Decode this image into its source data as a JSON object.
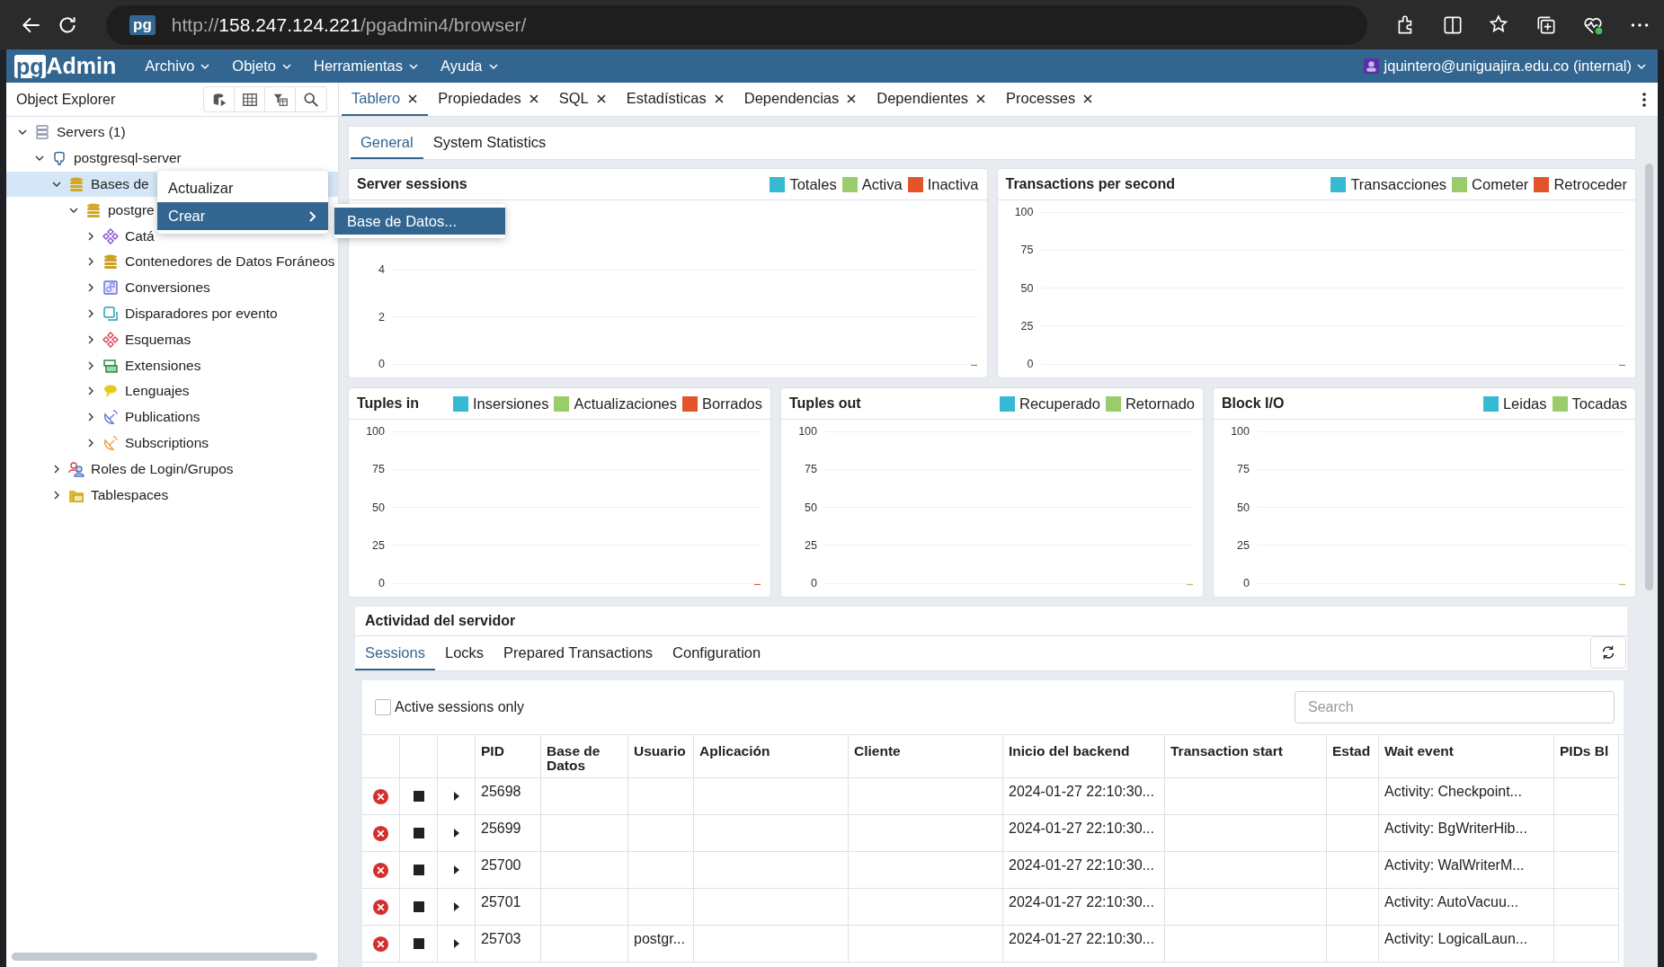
{
  "browser": {
    "url_scheme": "http://",
    "url_host": "158.247.124.221",
    "url_path": "/pgadmin4/browser/",
    "favicon": "pg"
  },
  "app": {
    "logo_a": "pg",
    "logo_b": "Admin",
    "menu": [
      "Archivo",
      "Objeto",
      "Herramientas",
      "Ayuda"
    ],
    "user": "jquintero@uniguajira.edu.co (internal)"
  },
  "explorer": {
    "title": "Object Explorer",
    "tree": [
      {
        "label": "Servers (1)",
        "kind": "servers",
        "expanded": true,
        "selected": false,
        "children": [
          {
            "label": "postgresql-server",
            "kind": "server",
            "expanded": true,
            "selected": false,
            "children": [
              {
                "label": "Bases de",
                "kind": "database",
                "expanded": true,
                "selected": true,
                "children": [
                  {
                    "label": "postgre",
                    "kind": "database",
                    "expanded": true,
                    "selected": false,
                    "children": [
                      {
                        "label": "Catá",
                        "kind": "catalog",
                        "expanded": false,
                        "selected": false
                      },
                      {
                        "label": "Contenedores de Datos Foráneos",
                        "kind": "fdw",
                        "expanded": false,
                        "selected": false
                      },
                      {
                        "label": "Conversiones",
                        "kind": "conversion",
                        "expanded": false,
                        "selected": false
                      },
                      {
                        "label": "Disparadores por evento",
                        "kind": "trigger",
                        "expanded": false,
                        "selected": false
                      },
                      {
                        "label": "Esquemas",
                        "kind": "schema",
                        "expanded": false,
                        "selected": false
                      },
                      {
                        "label": "Extensiones",
                        "kind": "extension",
                        "expanded": false,
                        "selected": false
                      },
                      {
                        "label": "Lenguajes",
                        "kind": "language",
                        "expanded": false,
                        "selected": false
                      },
                      {
                        "label": "Publications",
                        "kind": "publication",
                        "expanded": false,
                        "selected": false
                      },
                      {
                        "label": "Subscriptions",
                        "kind": "subscription",
                        "expanded": false,
                        "selected": false
                      }
                    ]
                  }
                ]
              },
              {
                "label": "Roles de Login/Grupos",
                "kind": "role",
                "expanded": false,
                "selected": false
              },
              {
                "label": "Tablespaces",
                "kind": "tablespace",
                "expanded": false,
                "selected": false
              }
            ]
          }
        ]
      }
    ]
  },
  "context_menu": {
    "items": [
      {
        "label": "Actualizar",
        "selected": false,
        "kind": "action"
      },
      {
        "label": "Crear",
        "selected": true,
        "kind": "submenu"
      }
    ],
    "submenu": [
      "Base de Datos..."
    ]
  },
  "tabs": [
    {
      "label": "Tablero",
      "selected": true
    },
    {
      "label": "Propiedades",
      "selected": false
    },
    {
      "label": "SQL",
      "selected": false
    },
    {
      "label": "Estadísticas",
      "selected": false
    },
    {
      "label": "Dependencias",
      "selected": false
    },
    {
      "label": "Dependientes",
      "selected": false
    },
    {
      "label": "Processes",
      "selected": false
    }
  ],
  "dashboard_tabs": [
    {
      "label": "General",
      "selected": true
    },
    {
      "label": "System Statistics",
      "selected": false
    }
  ],
  "charts_row_1": [
    {
      "title": "Server sessions",
      "legend": [
        {
          "name": "Totales",
          "color": "#36b9d3"
        },
        {
          "name": "Activa",
          "color": "#9bcc6a"
        },
        {
          "name": "Inactiva",
          "color": "#e4542b"
        }
      ],
      "yticks": [
        "4",
        "2",
        "0"
      ]
    },
    {
      "title": "Transactions per second",
      "legend": [
        {
          "name": "Transacciones",
          "color": "#36b9d3"
        },
        {
          "name": "Cometer",
          "color": "#9bcc6a"
        },
        {
          "name": "Retroceder",
          "color": "#e4542b"
        }
      ],
      "yticks": [
        "100",
        "75",
        "50",
        "25",
        "0"
      ]
    }
  ],
  "charts_row_2": [
    {
      "title": "Tuples in",
      "legend": [
        {
          "name": "Insersiones",
          "color": "#36b9d3"
        },
        {
          "name": "Actualizaciones",
          "color": "#9bcc6a"
        },
        {
          "name": "Borrados",
          "color": "#e4542b"
        }
      ],
      "yticks": [
        "100",
        "75",
        "50",
        "25",
        "0"
      ]
    },
    {
      "title": "Tuples out",
      "legend": [
        {
          "name": "Recuperado",
          "color": "#36b9d3"
        },
        {
          "name": "Retornado",
          "color": "#9bcc6a"
        }
      ],
      "yticks": [
        "100",
        "75",
        "50",
        "25",
        "0"
      ]
    },
    {
      "title": "Block I/O",
      "legend": [
        {
          "name": "Leidas",
          "color": "#36b9d3"
        },
        {
          "name": "Tocadas",
          "color": "#9bcc6a"
        }
      ],
      "yticks": [
        "100",
        "75",
        "50",
        "25",
        "0"
      ]
    }
  ],
  "activity": {
    "title": "Actividad del servidor",
    "tabs": [
      {
        "label": "Sessions",
        "selected": true
      },
      {
        "label": "Locks",
        "selected": false
      },
      {
        "label": "Prepared Transactions",
        "selected": false
      },
      {
        "label": "Configuration",
        "selected": false
      }
    ],
    "active_only": {
      "label": "Active sessions only",
      "checked": false
    },
    "search": {
      "placeholder": "Search"
    },
    "columns": [
      "PID",
      "Base de Datos",
      "Usuario",
      "Aplicación",
      "Cliente",
      "Inicio del backend",
      "Transaction start",
      "Estad",
      "Wait event",
      "PIDs Bl"
    ],
    "rows": [
      {
        "pid": "25698",
        "backend_start": "2024-01-27 22:10:30...",
        "wait_event": "Activity: Checkpoint..."
      },
      {
        "pid": "25699",
        "backend_start": "2024-01-27 22:10:30...",
        "wait_event": "Activity: BgWriterHib..."
      },
      {
        "pid": "25700",
        "backend_start": "2024-01-27 22:10:30...",
        "wait_event": "Activity: WalWriterM..."
      },
      {
        "pid": "25701",
        "backend_start": "2024-01-27 22:10:30...",
        "wait_event": "Activity: AutoVacuu..."
      },
      {
        "pid": "25703",
        "user": "postgr...",
        "backend_start": "2024-01-27 22:10:30...",
        "wait_event": "Activity: LogicalLaun..."
      }
    ]
  }
}
